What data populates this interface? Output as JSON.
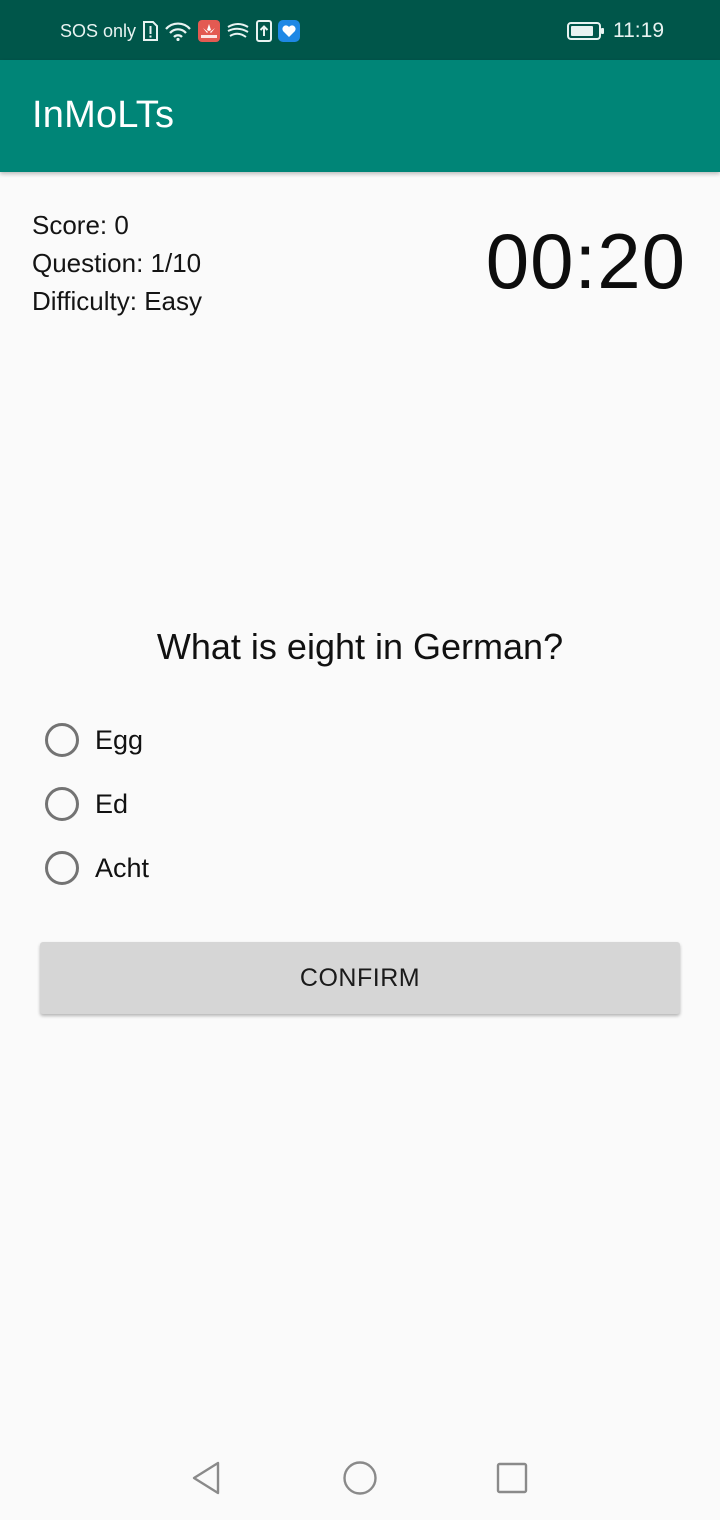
{
  "status_bar": {
    "carrier": "SOS only",
    "time": "11:19",
    "icons": [
      "sim-alert-icon",
      "wifi-icon",
      "huawei-app-icon",
      "swirl-app-icon",
      "upload-icon",
      "heart-app-icon",
      "battery-icon"
    ]
  },
  "app_bar": {
    "title": "InMoLTs"
  },
  "quiz": {
    "score": "Score: 0",
    "question_count": "Question: 1/10",
    "difficulty": "Difficulty: Easy",
    "timer": "00:20",
    "question": "What is eight in German?",
    "options": [
      "Egg",
      "Ed",
      "Acht"
    ],
    "confirm_label": "CONFIRM"
  },
  "nav_bar": {
    "buttons": [
      "back-icon",
      "home-icon",
      "recents-icon"
    ]
  },
  "colors": {
    "status_bar": "#00564a",
    "app_bar": "#008577",
    "background": "#fafafa",
    "button": "#d6d6d6"
  }
}
